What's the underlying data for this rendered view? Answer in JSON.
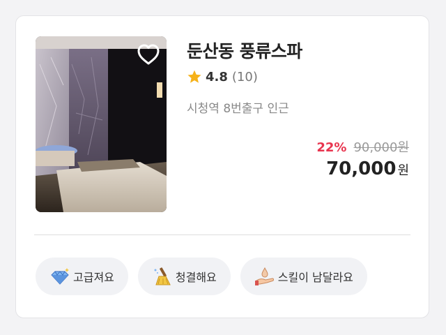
{
  "listing": {
    "title": "둔산동 풍류스파",
    "rating": "4.8",
    "review_count": "(10)",
    "location": "시청역 8번출구 인근",
    "discount": "22%",
    "original_price": "90,000원",
    "final_price": "70,000",
    "currency": "원",
    "favorite_icon": "heart-outline-icon",
    "rating_icon": "star-icon",
    "colors": {
      "discount": "#e8344e",
      "star": "#f6b21a",
      "tag_background": "#f1f2f5"
    }
  },
  "tags": [
    {
      "label": "고급져요",
      "icon": "diamond-icon"
    },
    {
      "label": "청결해요",
      "icon": "broom-icon"
    },
    {
      "label": "스킬이 남달라요",
      "icon": "massage-hand-icon"
    }
  ]
}
